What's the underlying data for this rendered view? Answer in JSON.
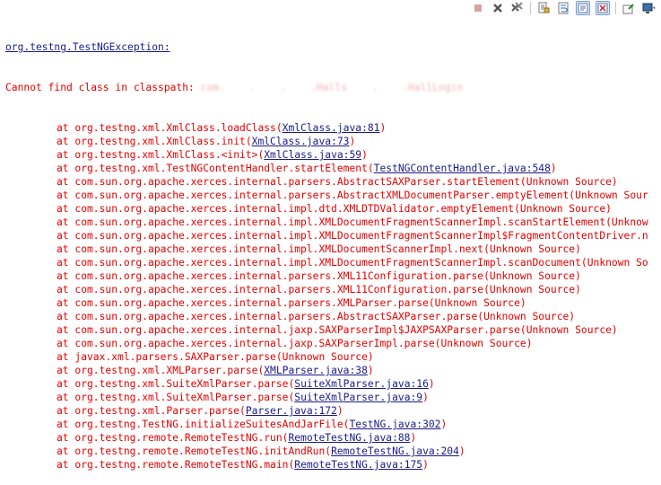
{
  "toolbar": {
    "buttons": [
      {
        "icon": "terminate-icon",
        "enabled": false
      },
      {
        "icon": "remove-launch-icon",
        "enabled": true
      },
      {
        "icon": "remove-all-terminated-icon",
        "enabled": true
      },
      {
        "icon": "scroll-lock-icon",
        "enabled": true
      },
      {
        "icon": "word-wrap-icon",
        "enabled": true
      },
      {
        "icon": "show-on-stdout-icon",
        "enabled": true,
        "active": true
      },
      {
        "icon": "show-on-stderr-icon",
        "enabled": true,
        "active": true
      },
      {
        "icon": "pin-console-icon",
        "enabled": true
      },
      {
        "icon": "display-console-icon",
        "enabled": true
      }
    ]
  },
  "console": {
    "exception_class": "org.testng.TestNGException:",
    "error_message": "Cannot find class in classpath: ",
    "error_class_redacted": "com.    .    .    .Halls    .    .HallLogin",
    "frames": [
      {
        "method": "at org.testng.xml.XmlClass.loadClass(",
        "link": "XmlClass.java:81",
        "end": ")"
      },
      {
        "method": "at org.testng.xml.XmlClass.init(",
        "link": "XmlClass.java:73",
        "end": ")"
      },
      {
        "method": "at org.testng.xml.XmlClass.<init>(",
        "link": "XmlClass.java:59",
        "end": ")"
      },
      {
        "method": "at org.testng.xml.TestNGContentHandler.startElement(",
        "link": "TestNGContentHandler.java:548",
        "end": ")"
      },
      {
        "method": "at com.sun.org.apache.xerces.internal.parsers.AbstractSAXParser.startElement(Unknown Source)",
        "link": "",
        "end": ""
      },
      {
        "method": "at com.sun.org.apache.xerces.internal.parsers.AbstractXMLDocumentParser.emptyElement(Unknown Sour",
        "link": "",
        "end": ""
      },
      {
        "method": "at com.sun.org.apache.xerces.internal.impl.dtd.XMLDTDValidator.emptyElement(Unknown Source)",
        "link": "",
        "end": ""
      },
      {
        "method": "at com.sun.org.apache.xerces.internal.impl.XMLDocumentFragmentScannerImpl.scanStartElement(Unknow",
        "link": "",
        "end": ""
      },
      {
        "method": "at com.sun.org.apache.xerces.internal.impl.XMLDocumentFragmentScannerImpl$FragmentContentDriver.n",
        "link": "",
        "end": ""
      },
      {
        "method": "at com.sun.org.apache.xerces.internal.impl.XMLDocumentScannerImpl.next(Unknown Source)",
        "link": "",
        "end": ""
      },
      {
        "method": "at com.sun.org.apache.xerces.internal.impl.XMLDocumentFragmentScannerImpl.scanDocument(Unknown So",
        "link": "",
        "end": ""
      },
      {
        "method": "at com.sun.org.apache.xerces.internal.parsers.XML11Configuration.parse(Unknown Source)",
        "link": "",
        "end": ""
      },
      {
        "method": "at com.sun.org.apache.xerces.internal.parsers.XML11Configuration.parse(Unknown Source)",
        "link": "",
        "end": ""
      },
      {
        "method": "at com.sun.org.apache.xerces.internal.parsers.XMLParser.parse(Unknown Source)",
        "link": "",
        "end": ""
      },
      {
        "method": "at com.sun.org.apache.xerces.internal.parsers.AbstractSAXParser.parse(Unknown Source)",
        "link": "",
        "end": ""
      },
      {
        "method": "at com.sun.org.apache.xerces.internal.jaxp.SAXParserImpl$JAXPSAXParser.parse(Unknown Source)",
        "link": "",
        "end": ""
      },
      {
        "method": "at com.sun.org.apache.xerces.internal.jaxp.SAXParserImpl.parse(Unknown Source)",
        "link": "",
        "end": ""
      },
      {
        "method": "at javax.xml.parsers.SAXParser.parse(Unknown Source)",
        "link": "",
        "end": ""
      },
      {
        "method": "at org.testng.xml.XMLParser.parse(",
        "link": "XMLParser.java:38",
        "end": ")"
      },
      {
        "method": "at org.testng.xml.SuiteXmlParser.parse(",
        "link": "SuiteXmlParser.java:16",
        "end": ")"
      },
      {
        "method": "at org.testng.xml.SuiteXmlParser.parse(",
        "link": "SuiteXmlParser.java:9",
        "end": ")"
      },
      {
        "method": "at org.testng.xml.Parser.parse(",
        "link": "Parser.java:172",
        "end": ")"
      },
      {
        "method": "at org.testng.TestNG.initializeSuitesAndJarFile(",
        "link": "TestNG.java:302",
        "end": ")"
      },
      {
        "method": "at org.testng.remote.RemoteTestNG.run(",
        "link": "RemoteTestNG.java:88",
        "end": ")"
      },
      {
        "method": "at org.testng.remote.RemoteTestNG.initAndRun(",
        "link": "RemoteTestNG.java:204",
        "end": ")"
      },
      {
        "method": "at org.testng.remote.RemoteTestNG.main(",
        "link": "RemoteTestNG.java:175",
        "end": ")"
      }
    ]
  },
  "colors": {
    "error": "#e40000",
    "link": "#1a1a8c",
    "exception": "#1f3fa8"
  }
}
